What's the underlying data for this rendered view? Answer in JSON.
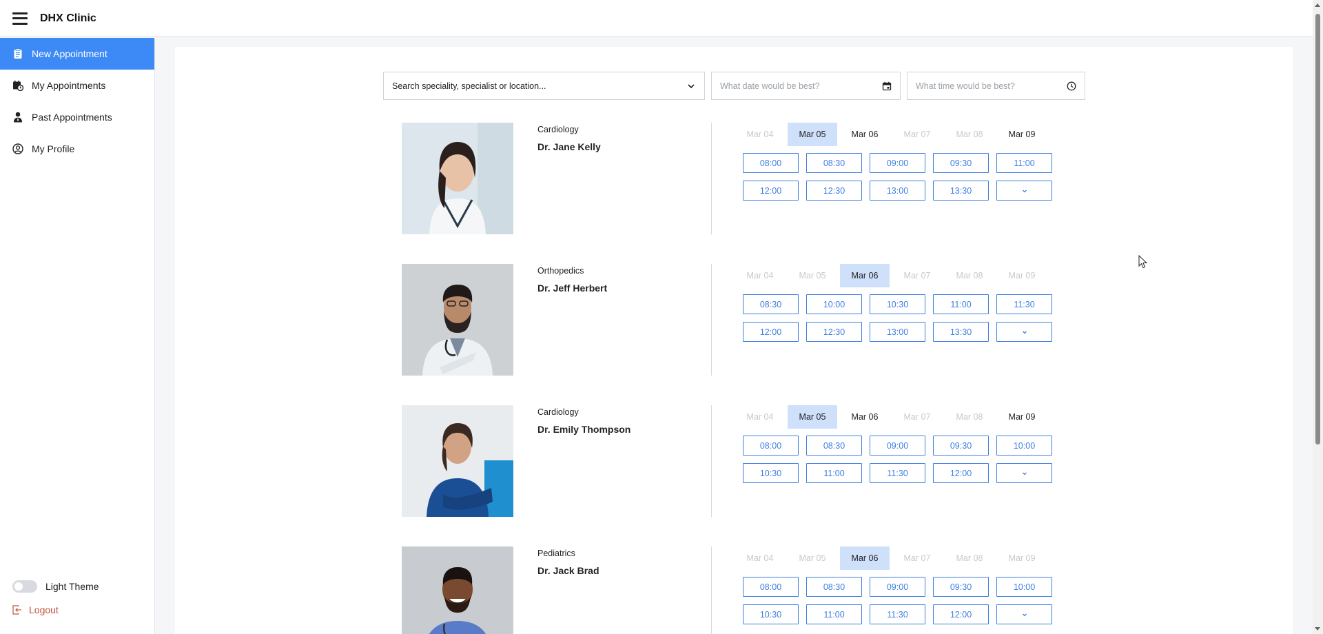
{
  "app": {
    "title": "DHX Clinic"
  },
  "sidebar": {
    "items": [
      {
        "label": "New Appointment",
        "icon": "clipboard-icon",
        "active": true
      },
      {
        "label": "My Appointments",
        "icon": "calendar-clock-icon",
        "active": false
      },
      {
        "label": "Past Appointments",
        "icon": "user-doctor-icon",
        "active": false
      },
      {
        "label": "My Profile",
        "icon": "user-circle-icon",
        "active": false
      }
    ],
    "theme_label": "Light Theme",
    "logout_label": "Logout"
  },
  "filters": {
    "search_placeholder": "Search speciality, specialist or location...",
    "date_placeholder": "What date would be best?",
    "time_placeholder": "What time would be best?"
  },
  "doctors": [
    {
      "speciality": "Cardiology",
      "name": "Dr. Jane Kelly",
      "dates": [
        {
          "label": "Mar 04",
          "state": "disabled"
        },
        {
          "label": "Mar 05",
          "state": "selected"
        },
        {
          "label": "Mar 06",
          "state": "available"
        },
        {
          "label": "Mar 07",
          "state": "disabled"
        },
        {
          "label": "Mar 08",
          "state": "disabled"
        },
        {
          "label": "Mar 09",
          "state": "available"
        }
      ],
      "slots": [
        "08:00",
        "08:30",
        "09:00",
        "09:30",
        "11:00",
        "12:00",
        "12:30",
        "13:00",
        "13:30"
      ]
    },
    {
      "speciality": "Orthopedics",
      "name": "Dr. Jeff Herbert",
      "dates": [
        {
          "label": "Mar 04",
          "state": "disabled"
        },
        {
          "label": "Mar 05",
          "state": "disabled"
        },
        {
          "label": "Mar 06",
          "state": "selected"
        },
        {
          "label": "Mar 07",
          "state": "disabled"
        },
        {
          "label": "Mar 08",
          "state": "disabled"
        },
        {
          "label": "Mar 09",
          "state": "disabled"
        }
      ],
      "slots": [
        "08:30",
        "10:00",
        "10:30",
        "11:00",
        "11:30",
        "12:00",
        "12:30",
        "13:00",
        "13:30"
      ]
    },
    {
      "speciality": "Cardiology",
      "name": "Dr. Emily Thompson",
      "dates": [
        {
          "label": "Mar 04",
          "state": "disabled"
        },
        {
          "label": "Mar 05",
          "state": "selected"
        },
        {
          "label": "Mar 06",
          "state": "available"
        },
        {
          "label": "Mar 07",
          "state": "disabled"
        },
        {
          "label": "Mar 08",
          "state": "disabled"
        },
        {
          "label": "Mar 09",
          "state": "available"
        }
      ],
      "slots": [
        "08:00",
        "08:30",
        "09:00",
        "09:30",
        "10:00",
        "10:30",
        "11:00",
        "11:30",
        "12:00"
      ]
    },
    {
      "speciality": "Pediatrics",
      "name": "Dr. Jack Brad",
      "dates": [
        {
          "label": "Mar 04",
          "state": "disabled"
        },
        {
          "label": "Mar 05",
          "state": "disabled"
        },
        {
          "label": "Mar 06",
          "state": "selected"
        },
        {
          "label": "Mar 07",
          "state": "disabled"
        },
        {
          "label": "Mar 08",
          "state": "disabled"
        },
        {
          "label": "Mar 09",
          "state": "disabled"
        }
      ],
      "slots": [
        "08:00",
        "08:30",
        "09:00",
        "09:30",
        "10:00",
        "10:30",
        "11:00",
        "11:30",
        "12:00"
      ]
    }
  ],
  "colors": {
    "accent": "#3d8af7",
    "slot_border": "#3d7fe0",
    "selected_date_bg": "#cfe0fb",
    "logout": "#c0533d"
  }
}
